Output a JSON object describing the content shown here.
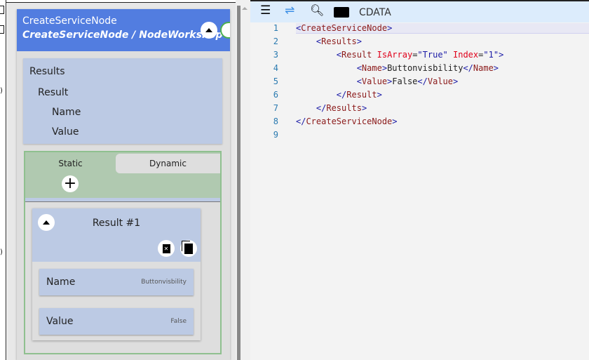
{
  "node": {
    "title": "CreateServiceNode",
    "subtitle": "CreateServiceNode / NodeWorkshop"
  },
  "tree": [
    "Results",
    "Result",
    "Name",
    "Value"
  ],
  "tabs": {
    "static": "Static",
    "dynamic": "Dynamic"
  },
  "result": {
    "title": "Result #1",
    "fields": [
      {
        "label": "Name",
        "value": "Buttonvisbility"
      },
      {
        "label": "Value",
        "value": "False"
      }
    ]
  },
  "toolbar": {
    "cdata": "CDATA"
  },
  "code": {
    "line_numbers": [
      "1",
      "2",
      "3",
      "4",
      "5",
      "6",
      "7",
      "8",
      "9"
    ],
    "lines": [
      [
        {
          "t": "<",
          "c": "tg"
        },
        {
          "t": "CreateServiceNode",
          "c": "nm"
        },
        {
          "t": ">",
          "c": "tg"
        }
      ],
      [
        {
          "t": "    <",
          "c": "tg"
        },
        {
          "t": "Results",
          "c": "nm"
        },
        {
          "t": ">",
          "c": "tg"
        }
      ],
      [
        {
          "t": "        <",
          "c": "tg"
        },
        {
          "t": "Result",
          "c": "nm"
        },
        {
          "t": " IsArray",
          "c": "at"
        },
        {
          "t": "=",
          "c": ""
        },
        {
          "t": "\"True\"",
          "c": "av"
        },
        {
          "t": " Index",
          "c": "at"
        },
        {
          "t": "=",
          "c": ""
        },
        {
          "t": "\"1\"",
          "c": "av"
        },
        {
          "t": ">",
          "c": "tg"
        }
      ],
      [
        {
          "t": "            <",
          "c": "tg"
        },
        {
          "t": "Name",
          "c": "nm"
        },
        {
          "t": ">",
          "c": "tg"
        },
        {
          "t": "Buttonvisbility",
          "c": ""
        },
        {
          "t": "</",
          "c": "tg"
        },
        {
          "t": "Name",
          "c": "nm"
        },
        {
          "t": ">",
          "c": "tg"
        }
      ],
      [
        {
          "t": "            <",
          "c": "tg"
        },
        {
          "t": "Value",
          "c": "nm"
        },
        {
          "t": ">",
          "c": "tg"
        },
        {
          "t": "False",
          "c": ""
        },
        {
          "t": "</",
          "c": "tg"
        },
        {
          "t": "Value",
          "c": "nm"
        },
        {
          "t": ">",
          "c": "tg"
        }
      ],
      [
        {
          "t": "        </",
          "c": "tg"
        },
        {
          "t": "Result",
          "c": "nm"
        },
        {
          "t": ">",
          "c": "tg"
        }
      ],
      [
        {
          "t": "    </",
          "c": "tg"
        },
        {
          "t": "Results",
          "c": "nm"
        },
        {
          "t": ">",
          "c": "tg"
        }
      ],
      [
        {
          "t": "</",
          "c": "tg"
        },
        {
          "t": "CreateServiceNode",
          "c": "nm"
        },
        {
          "t": ">",
          "c": "tg"
        }
      ],
      []
    ]
  },
  "colors": {
    "header": "#527de0",
    "card": "#bccae4",
    "static_tab": "#b0c9b0",
    "toolbar": "#dcecfc"
  }
}
